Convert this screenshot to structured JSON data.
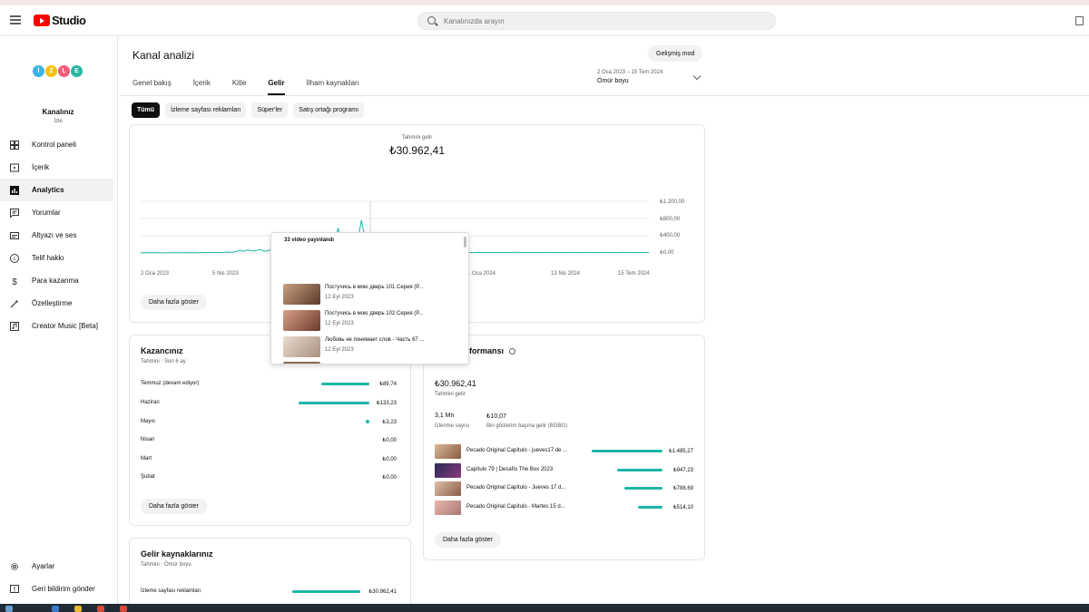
{
  "header": {
    "logo_text": "Studio",
    "search_placeholder": "Kanalınızda arayın"
  },
  "sidebar": {
    "avatar_letters": [
      "İ",
      "Z",
      "L",
      "E"
    ],
    "avatar_colors": [
      "#3bb4e5",
      "#f4c20d",
      "#ef5b79",
      "#26b8a0"
    ],
    "channel_name": "Kanalınız",
    "channel_handle": "İzle",
    "items": [
      {
        "label": "Kontrol paneli",
        "icon": "dashboard-icon"
      },
      {
        "label": "İçerik",
        "icon": "content-icon"
      },
      {
        "label": "Analytics",
        "icon": "analytics-icon",
        "active": true
      },
      {
        "label": "Yorumlar",
        "icon": "comments-icon"
      },
      {
        "label": "Altyazı ve ses",
        "icon": "subtitles-icon"
      },
      {
        "label": "Telif hakkı",
        "icon": "copyright-icon"
      },
      {
        "label": "Para kazanma",
        "icon": "dollar-icon"
      },
      {
        "label": "Özelleştirme",
        "icon": "magic-wand-icon"
      },
      {
        "label": "Creator Music [Beta]",
        "icon": "music-icon"
      }
    ],
    "bottom_items": [
      {
        "label": "Ayarlar",
        "icon": "gear-icon"
      },
      {
        "label": "Geri bildirim gönder",
        "icon": "feedback-icon"
      }
    ]
  },
  "main": {
    "title": "Kanal analizi",
    "advanced_mode": "Gelişmiş mod",
    "tabs": [
      "Genel bakış",
      "İçerik",
      "Kitle",
      "Gelir",
      "İlham kaynakları"
    ],
    "active_tab": "Gelir",
    "date_range": "2 Oca 2023 – 15 Tem 2024",
    "date_preset": "Ömür boyu",
    "chips": [
      "Tümü",
      "İzleme sayfası reklamları",
      "Süper'ler",
      "Satış ortağı programı"
    ]
  },
  "revenue_chart": {
    "label": "Tahmini gelir",
    "value": "₺30.962,41",
    "show_more": "Daha fazla göster",
    "markers": [
      "11",
      "33"
    ]
  },
  "chart_data": {
    "type": "line",
    "title": "Tahmini gelir",
    "ylim": [
      0,
      1200
    ],
    "yticks": [
      "₺1.200,00",
      "₺800,00",
      "₺400,00",
      "₺0,00"
    ],
    "xticks": [
      "2 Oca 2023",
      "5 Nis 2023",
      "1 Oca 2024",
      "13 Nis 2024",
      "15 Tem 2024"
    ],
    "color": "#1cb5a8",
    "series": [
      {
        "values": [
          5,
          4,
          6,
          5,
          8,
          5,
          4,
          6,
          3,
          5,
          4,
          7,
          5,
          6,
          4,
          5,
          6,
          8,
          7,
          5,
          6,
          9,
          10,
          8,
          12,
          14,
          10,
          9,
          11,
          15,
          20,
          16,
          24,
          32,
          60,
          40,
          50,
          70,
          55,
          45,
          60,
          80,
          50,
          40,
          55,
          90,
          60,
          120,
          180,
          130,
          160,
          240,
          200,
          160,
          260,
          320,
          210,
          240,
          180,
          140,
          200,
          160,
          150,
          130,
          210,
          250,
          170,
          320,
          580,
          280,
          230,
          200,
          300,
          260,
          210,
          360,
          760,
          420,
          290,
          340,
          250,
          220,
          310,
          300,
          260,
          350,
          410,
          280,
          320,
          260,
          300,
          220,
          250,
          200,
          260,
          180,
          150,
          220,
          160,
          110,
          180,
          130,
          100,
          80,
          70,
          60,
          30,
          15,
          20,
          10,
          8,
          12,
          10,
          11,
          9,
          10,
          14,
          12,
          11,
          13,
          10,
          12,
          11,
          10,
          12,
          11,
          13,
          10,
          12,
          14,
          12,
          11,
          10,
          12,
          13,
          11,
          10,
          12,
          11,
          13,
          12,
          10,
          11,
          12,
          10,
          12,
          11,
          13,
          12,
          11,
          10,
          12,
          11,
          12,
          13,
          11,
          10,
          12,
          11,
          13,
          12,
          11,
          10,
          12,
          11,
          12,
          14,
          13,
          12,
          11,
          10,
          12,
          11,
          12,
          13,
          11
        ]
      }
    ]
  },
  "popup": {
    "title": "33 video yayınlandı",
    "items": [
      {
        "title": "Постучись в мою дверь 101 Серия (Р...",
        "date": "12 Eyl 2023",
        "thumb_color": "#7a5a3a"
      },
      {
        "title": "Постучись в мою дверь 102 Серия (Р...",
        "date": "12 Eyl 2023",
        "thumb_color": "#8a4a3a"
      },
      {
        "title": "Любовь не понимает слов - Часть 67 ...",
        "date": "12 Eyl 2023",
        "thumb_color": "#c9b6a6"
      }
    ]
  },
  "earnings": {
    "title": "Kazancınız",
    "subtitle": "Tahmini · Son 6 ay",
    "rows": [
      {
        "label": "Temmuz (devam ediyor)",
        "value": "₺89,74",
        "fraction": 0.67
      },
      {
        "label": "Haziran",
        "value": "₺133,23",
        "fraction": 1.0
      },
      {
        "label": "Mayıs",
        "value": "₺3,23",
        "fraction": 0.02
      },
      {
        "label": "Nisan",
        "value": "₺0,00",
        "fraction": 0
      },
      {
        "label": "Mart",
        "value": "₺0,00",
        "fraction": 0
      },
      {
        "label": "Şubat",
        "value": "₺0,00",
        "fraction": 0
      }
    ],
    "show_more": "Daha fazla göster"
  },
  "performance": {
    "title": "formansı",
    "total_value": "₺30.962,41",
    "total_label": "Tahmini gelir",
    "views_value": "3,1 Mn",
    "views_label": "İzlenme sayısı",
    "rpm_value": "₺10,07",
    "rpm_label": "Bin gösterim başına gelir (BGBG)",
    "videos": [
      {
        "title": "Pecado Original Capítulo - jueves17 de ...",
        "value": "₺1.485,27",
        "fraction": 1.0,
        "thumb_color": "#b88a6a"
      },
      {
        "title": "Capítulo 79 | Desafío The Box 2023",
        "value": "₺947,23",
        "fraction": 0.64,
        "thumb_color": "#4a3c5a"
      },
      {
        "title": "Pecado Original Capítulo - Jueves 17 d...",
        "value": "₺788,69",
        "fraction": 0.53,
        "thumb_color": "#a88068"
      },
      {
        "title": "Pecado Original Capítulo - Martes 15 d...",
        "value": "₺514,10",
        "fraction": 0.35,
        "thumb_color": "#c89a88"
      }
    ],
    "show_more": "Daha fazla göster"
  },
  "sources": {
    "title": "Gelir kaynaklarınız",
    "subtitle": "Tahmini · Ömür boyu",
    "rows": [
      {
        "label": "İzleme sayfası reklamları",
        "value": "₺30.962,41",
        "fraction": 1.0
      }
    ]
  }
}
